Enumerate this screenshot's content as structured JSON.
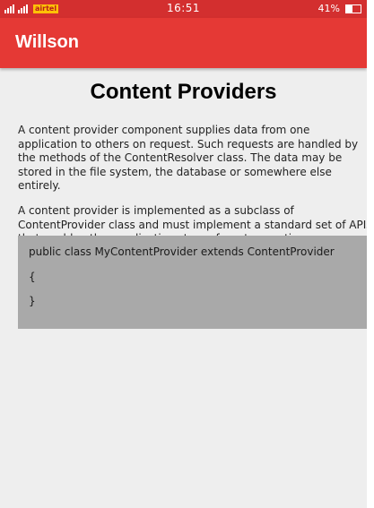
{
  "status_bar": {
    "time": "16:51",
    "battery_percent": "41%",
    "battery_level": 0.41,
    "carrier_badge": "airtel",
    "signal_icon": "signal-bars-icon",
    "battery_icon": "battery-icon"
  },
  "app_bar": {
    "title": "Willson",
    "color": "#e53935"
  },
  "content": {
    "title": "Content Providers",
    "paragraph1": "A content provider component supplies data from one application to others on request. Such requests are handled by the methods of the ContentResolver class. The data may be stored in the file system, the database or somewhere else entirely.",
    "paragraph2": "A content provider is implemented as a subclass of ContentProvider class and must implement a standard set of APIs that enable other applications to perform transactions.",
    "code": {
      "line1": "public class MyContentProvider extends ContentProvider",
      "line2": "{",
      "line3": "}",
      "background": "#a9a9a9"
    }
  }
}
